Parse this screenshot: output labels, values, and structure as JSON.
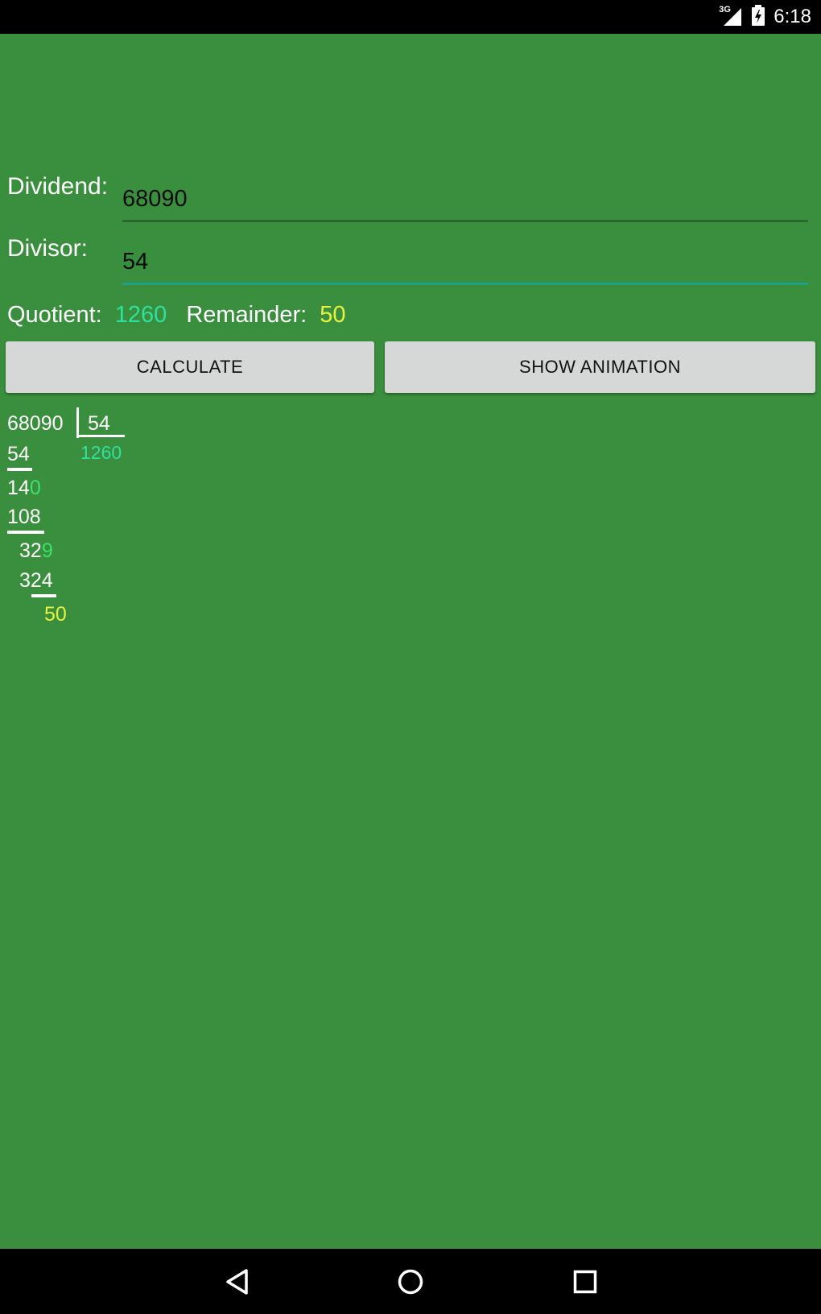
{
  "status_bar": {
    "network": "3G",
    "time": "6:18"
  },
  "form": {
    "dividend_label": "Dividend:",
    "dividend_value": "68090",
    "divisor_label": "Divisor:",
    "divisor_value": "54"
  },
  "result": {
    "quotient_label": "Quotient:",
    "quotient_value": "1260",
    "remainder_label": "Remainder:",
    "remainder_value": "50"
  },
  "buttons": {
    "calculate": "CALCULATE",
    "show_animation": "SHOW ANIMATION"
  },
  "long_division": {
    "dividend": "68090",
    "divisor": "54",
    "quotient": "1260",
    "steps": [
      {
        "subtract": "54",
        "partial": "14",
        "brought_down": "0"
      },
      {
        "subtract": "108",
        "partial": "32",
        "brought_down": "9"
      },
      {
        "subtract": "324"
      }
    ],
    "remainder": "50"
  },
  "colors": {
    "background": "#3a8f3e",
    "quotient": "#2ee0a0",
    "remainder": "#e8f23c",
    "brought_down": "#3ee06a",
    "field_underline": "#2a6a2e",
    "field_underline_focused": "#1fa08a"
  },
  "nav_bar": {
    "back": "back-icon",
    "home": "home-icon",
    "recents": "recents-icon"
  }
}
